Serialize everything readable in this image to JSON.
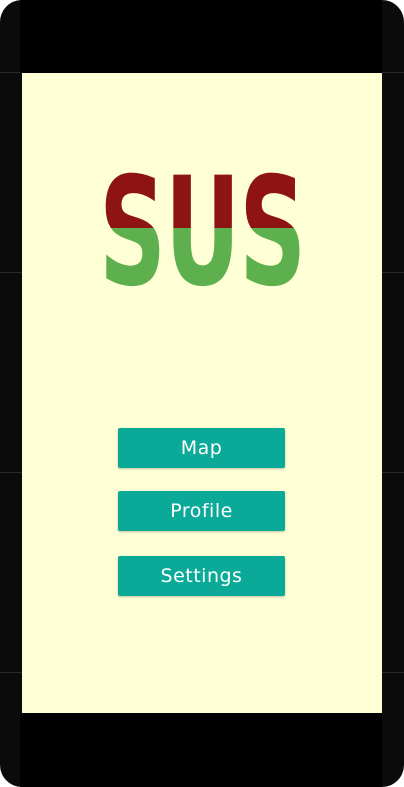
{
  "app": {
    "logo_text": "SUS",
    "colors": {
      "background": "#ffffd6",
      "logo_top": "#8e1414",
      "logo_bottom": "#5eb04e",
      "button": "#0baa98",
      "button_text": "#ffffff"
    }
  },
  "menu": {
    "map_label": "Map",
    "profile_label": "Profile",
    "settings_label": "Settings"
  }
}
